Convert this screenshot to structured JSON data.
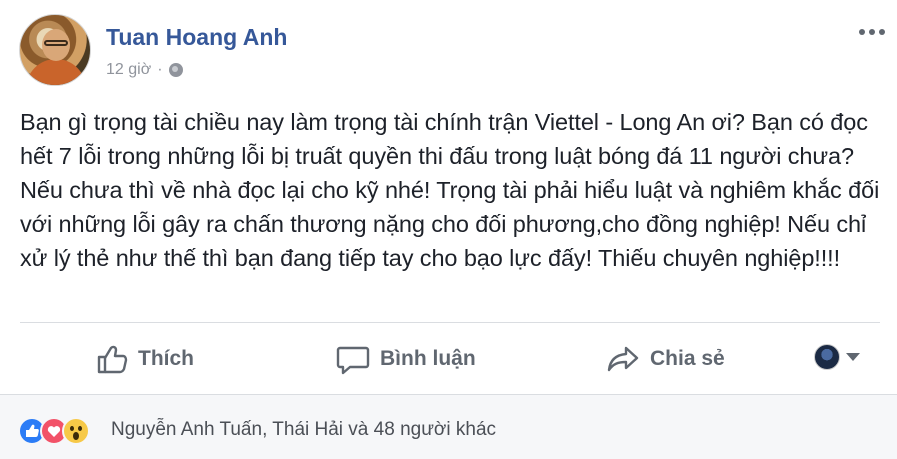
{
  "post": {
    "author": "Tuan Hoang Anh",
    "time": "12 giờ",
    "separator": "·",
    "text": "Bạn gì trọng tài chiều nay làm trọng tài chính trận Viettel - Long An ơi? Bạn có đọc hết 7 lỗi trong những lỗi bị truất quyền thi đấu trong luật bóng đá 11 người chưa? Nếu chưa thì về nhà đọc lại cho kỹ nhé! Trọng tài phải hiểu luật và nghiêm khắc đối với những lỗi gây ra chấn thương nặng cho đối phương,cho đồng nghiệp! Nếu chỉ xử lý thẻ như thế thì bạn đang tiếp tay cho bạo lực đấy! Thiếu chuyên nghiệp!!!!"
  },
  "actions": {
    "like": "Thích",
    "comment": "Bình luận",
    "share": "Chia sẻ"
  },
  "reactions": {
    "types": [
      "like",
      "love",
      "wow"
    ],
    "summary": "Nguyễn Anh Tuấn, Thái Hải và 48 người khác"
  },
  "colors": {
    "author": "#365899",
    "muted": "#90949c",
    "action": "#606770",
    "like": "#2b7cf6",
    "love": "#f25268",
    "wow": "#f7c948"
  }
}
